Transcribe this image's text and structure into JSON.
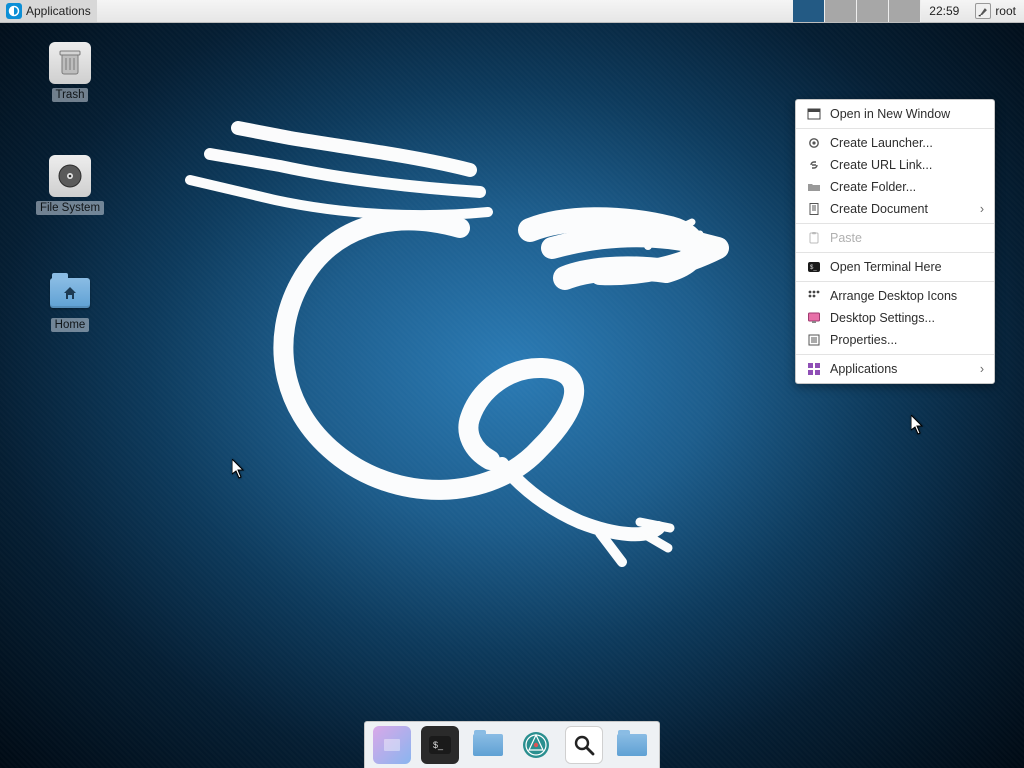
{
  "panel": {
    "menu_label": "Applications",
    "clock": "22:59",
    "user": "root",
    "workspaces": 4,
    "active_workspace": 0
  },
  "desktop_icons": {
    "trash": "Trash",
    "filesystem": "File System",
    "home": "Home"
  },
  "context_menu": {
    "open_new_window": "Open in New Window",
    "create_launcher": "Create Launcher...",
    "create_url": "Create URL Link...",
    "create_folder": "Create Folder...",
    "create_document": "Create Document",
    "paste": "Paste",
    "open_terminal": "Open Terminal Here",
    "arrange": "Arrange Desktop Icons",
    "settings": "Desktop Settings...",
    "properties": "Properties...",
    "applications": "Applications"
  },
  "dock": {
    "items": [
      "show-desktop",
      "terminal",
      "file-manager",
      "web-browser",
      "search",
      "folder"
    ]
  }
}
